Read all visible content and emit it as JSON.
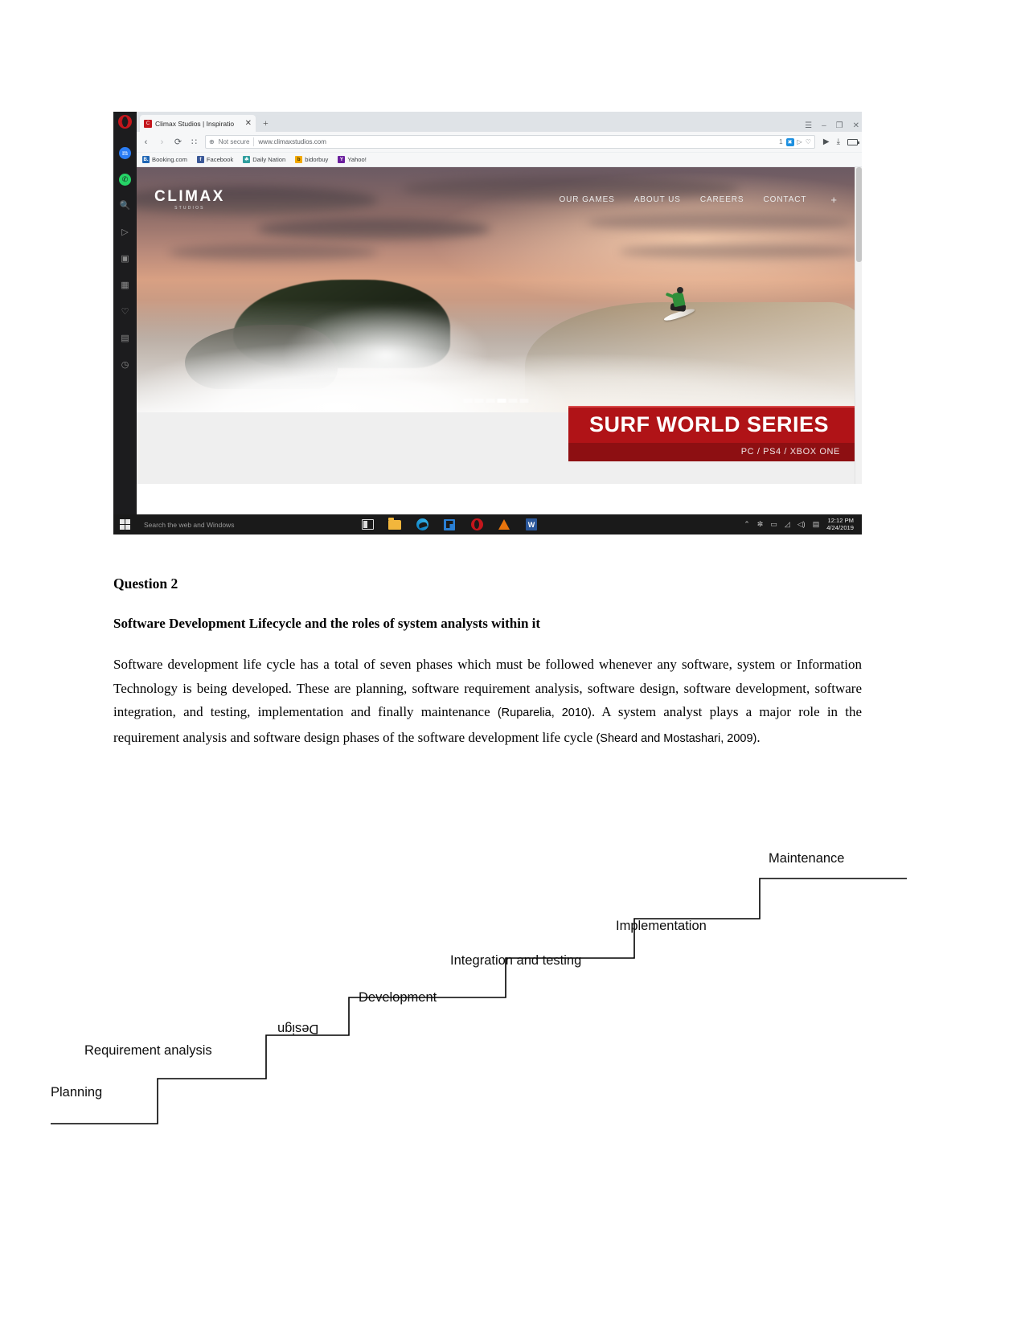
{
  "screenshot": {
    "browser": {
      "name": "Opera",
      "tab": {
        "favicon": "climax-favicon",
        "title": "Climax Studios | Inspiratio",
        "close_label": "✕"
      },
      "new_tab_label": "+",
      "window_controls": {
        "menu": "☰",
        "minimize": "–",
        "maximize": "❐",
        "close": "✕"
      },
      "nav": {
        "back": "‹",
        "forward": "›",
        "reload": "⟳",
        "speeddial": "∷"
      },
      "address": {
        "security_icon": "globe-icon",
        "security_text": "Not secure",
        "url": "www.climaxstudios.com",
        "blocker_count": "1",
        "blocker_icon": "shield-icon",
        "share_icon": "▷",
        "heart_icon": "♡"
      },
      "toolbar_right": {
        "play_icon": "▶",
        "download_icon": "⤓",
        "battery_icon": "battery-icon"
      },
      "bookmarks": [
        {
          "label": "Booking.com",
          "icon_letter": "B.",
          "color": "#1f66b5"
        },
        {
          "label": "Facebook",
          "icon_letter": "f",
          "color": "#3b5998"
        },
        {
          "label": "Daily Nation",
          "icon_letter": "☘",
          "color": "#2f9e9e"
        },
        {
          "label": "bidorbuy",
          "icon_letter": "b",
          "color": "#f2a900"
        },
        {
          "label": "Yahoo!",
          "icon_letter": "Y",
          "color": "#6b1f9e"
        }
      ],
      "sidebar_icons": [
        "messenger-icon",
        "whatsapp-icon",
        "search-icon",
        "telegram-icon",
        "instagram-icon",
        "speeddial-icon",
        "heart-icon",
        "news-icon",
        "history-icon",
        "panel-toggle-icon"
      ]
    },
    "website": {
      "brand": {
        "name": "CLIMAX",
        "sub": "STUDIOS"
      },
      "nav_links": [
        "OUR GAMES",
        "ABOUT US",
        "CAREERS",
        "CONTACT"
      ],
      "nav_plus": "+",
      "banner": {
        "title": "SURF WORLD SERIES",
        "platforms": "PC / PS4 / XBOX ONE"
      },
      "slider_dots": 6,
      "slider_active_index": 3
    },
    "taskbar": {
      "start_icon": "windows-icon",
      "search_placeholder": "Search the web and Windows",
      "apps": [
        "task-view-icon",
        "file-explorer-icon",
        "edge-icon",
        "store-icon",
        "opera-icon",
        "vlc-icon",
        "word-icon"
      ],
      "tray": [
        "chevron-up-icon",
        "bluetooth-icon",
        "network-icon",
        "wifi-icon",
        "volume-icon",
        "onedrive-icon"
      ],
      "clock_time": "12:12 PM",
      "clock_date": "4/24/2019"
    }
  },
  "document": {
    "question_heading": "Question 2",
    "subheading": "Software Development Lifecycle and the roles of system analysts within it",
    "paragraph": {
      "part1": "Software development life cycle has a total of seven phases which must be followed whenever any software, system or Information Technology is being developed. These are planning, software requirement analysis, software design, software development, software integration, and testing, implementation and finally maintenance ",
      "cite1": "(Ruparelia, 2010)",
      "part2": ". A system analyst plays a major role in the requirement analysis and software design phases of the software development life cycle ",
      "cite2": "(Sheard and Mostashari, 2009)",
      "part3": "."
    }
  },
  "diagram": {
    "type": "staircase",
    "steps": [
      {
        "label": "Planning",
        "index": 1
      },
      {
        "label": "Requirement analysis",
        "index": 2
      },
      {
        "label": "Design",
        "index": 3,
        "rotated": true
      },
      {
        "label": "Development",
        "index": 4
      },
      {
        "label": "Integration and testing",
        "index": 5
      },
      {
        "label": "Implementation",
        "index": 6
      },
      {
        "label": "Maintenance",
        "index": 7
      }
    ],
    "line_color": "#000000"
  }
}
